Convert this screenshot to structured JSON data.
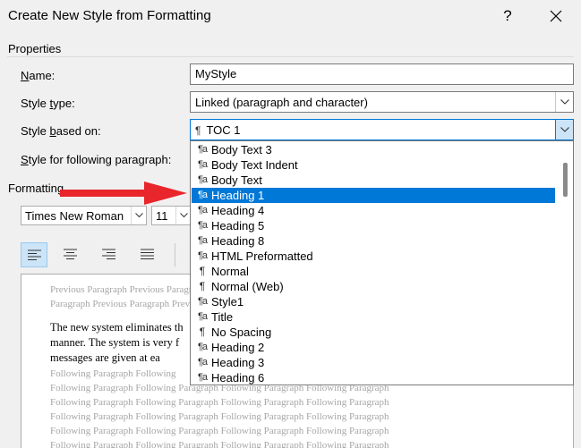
{
  "window": {
    "title": "Create New Style from Formatting",
    "help_label": "?"
  },
  "properties": {
    "group_label": "Properties",
    "name_label": "Name:",
    "name_value": "MyStyle",
    "style_type_label": "Style type:",
    "style_type_value": "Linked (paragraph and character)",
    "based_on_label": "Style based on:",
    "based_on_value": "TOC 1",
    "following_label": "Style for following paragraph:"
  },
  "formatting": {
    "group_label": "Formatting",
    "font_name": "Times New Roman",
    "font_size": "11"
  },
  "style_list": [
    {
      "label": "Body Text 3",
      "icon": "linked-style-icon"
    },
    {
      "label": "Body Text Indent",
      "icon": "linked-style-icon"
    },
    {
      "label": "Body Text",
      "icon": "linked-style-icon"
    },
    {
      "label": "Heading 1",
      "icon": "linked-style-icon",
      "selected": true
    },
    {
      "label": "Heading 4",
      "icon": "linked-style-icon"
    },
    {
      "label": "Heading 5",
      "icon": "linked-style-icon"
    },
    {
      "label": "Heading 8",
      "icon": "linked-style-icon"
    },
    {
      "label": "HTML Preformatted",
      "icon": "linked-style-icon"
    },
    {
      "label": "Normal",
      "icon": "paragraph-style-icon"
    },
    {
      "label": "Normal (Web)",
      "icon": "paragraph-style-icon"
    },
    {
      "label": "Style1",
      "icon": "linked-style-icon"
    },
    {
      "label": "Title",
      "icon": "linked-style-icon"
    },
    {
      "label": "No Spacing",
      "icon": "paragraph-style-icon"
    },
    {
      "label": "Heading 2",
      "icon": "linked-style-icon"
    },
    {
      "label": "Heading 3",
      "icon": "linked-style-icon"
    },
    {
      "label": "Heading 6",
      "icon": "linked-style-icon"
    }
  ],
  "preview": {
    "prev_1": "Previous Paragraph Previous Paragra",
    "prev_2": "Paragraph Previous Paragraph Previou",
    "body_1": "The new system eliminates th",
    "body_2": "manner. The system is very f",
    "body_3": "messages are given at ea",
    "follow_1": "Following Paragraph Following",
    "follow_2": "Following Paragraph Following Paragraph Following Paragraph Following Paragraph",
    "follow_3": "Following Paragraph Following Paragraph Following Paragraph Following Paragraph",
    "follow_4": "Following Paragraph Following Paragraph Following Paragraph Following Paragraph",
    "follow_5": "Following Paragraph Following Paragraph Following Paragraph Following Paragraph",
    "follow_6": "Following Paragraph Following Paragraph Following Paragraph Following Paragraph"
  },
  "colors": {
    "selection": "#0078d7",
    "annotation_arrow": "#e8262b"
  }
}
